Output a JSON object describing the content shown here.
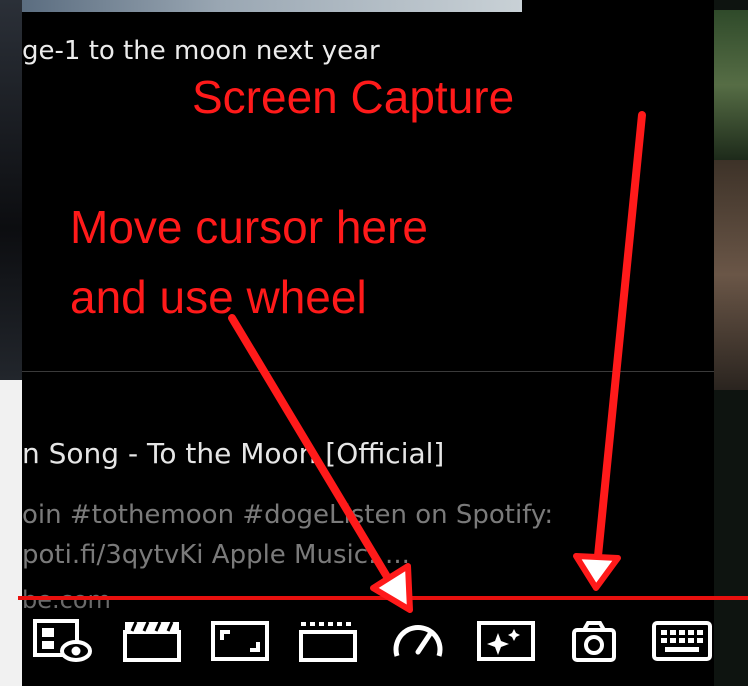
{
  "background": {
    "accent_red": "#e8100e"
  },
  "player": {
    "title_text": "ge-1 to the moon next year"
  },
  "card": {
    "title": "n Song - To the Moon [Official]",
    "description_line1": "oin #tothemoon #dogeListen on Spotify:",
    "description_line2": "poti.fi/3qytvKi Apple Music: ...",
    "source": "be.com"
  },
  "annotations": {
    "screen_capture": "Screen Capture",
    "move_cursor_line1": "Move cursor here",
    "move_cursor_line2": "and use wheel"
  },
  "toolbar": {
    "buttons": [
      {
        "name": "picture-in-picture-icon"
      },
      {
        "name": "clapperboard-icon"
      },
      {
        "name": "fit-screen-icon"
      },
      {
        "name": "theater-mode-icon"
      },
      {
        "name": "speedometer-icon"
      },
      {
        "name": "enhance-sparkle-icon"
      },
      {
        "name": "camera-icon"
      },
      {
        "name": "keyboard-icon"
      }
    ]
  }
}
